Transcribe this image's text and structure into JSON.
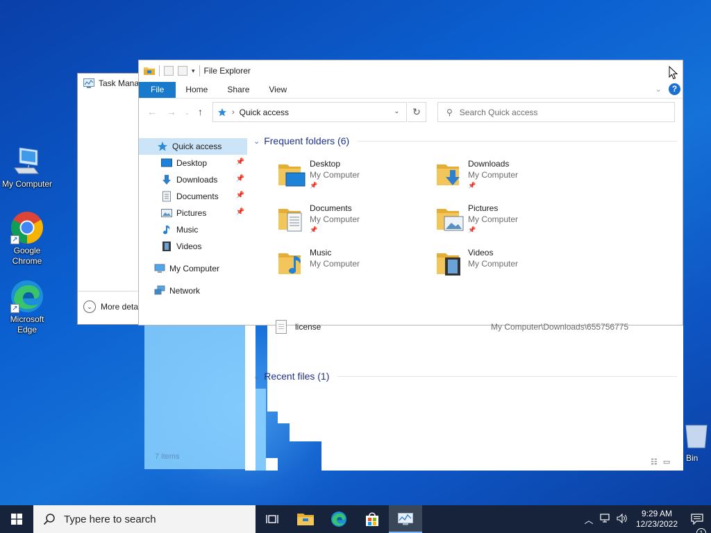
{
  "desktop": {
    "icons": [
      {
        "label": "My Computer"
      },
      {
        "label": "Google Chrome"
      },
      {
        "label": "Microsoft Edge"
      }
    ],
    "recycle_bin_label": "Bin"
  },
  "task_manager": {
    "title": "Task Manag",
    "more_details": "More deta"
  },
  "explorer": {
    "title": "File Explorer",
    "ribbon_tabs": [
      "File",
      "Home",
      "Share",
      "View"
    ],
    "address": "Quick access",
    "search_placeholder": "Search Quick access",
    "nav": [
      {
        "label": "Quick access",
        "icon": "star-icon"
      },
      {
        "label": "Desktop",
        "icon": "desktop-icon",
        "pinned": true
      },
      {
        "label": "Downloads",
        "icon": "download-arrow-icon",
        "pinned": true
      },
      {
        "label": "Documents",
        "icon": "document-icon",
        "pinned": true
      },
      {
        "label": "Pictures",
        "icon": "picture-icon",
        "pinned": true
      },
      {
        "label": "Music",
        "icon": "music-note-icon"
      },
      {
        "label": "Videos",
        "icon": "film-icon"
      },
      {
        "label": "My Computer",
        "icon": "computer-icon"
      },
      {
        "label": "Network",
        "icon": "network-icon"
      }
    ],
    "frequent_header": "Frequent folders (6)",
    "folders": [
      {
        "name": "Desktop",
        "location": "My Computer",
        "pinned": true
      },
      {
        "name": "Downloads",
        "location": "My Computer",
        "pinned": true
      },
      {
        "name": "Documents",
        "location": "My Computer",
        "pinned": true
      },
      {
        "name": "Pictures",
        "location": "My Computer",
        "pinned": true
      },
      {
        "name": "Music",
        "location": "My Computer",
        "pinned": false
      },
      {
        "name": "Videos",
        "location": "My Computer",
        "pinned": false
      }
    ],
    "recent_header": "Recent files (1)",
    "recent_files": [
      {
        "name": "license",
        "path": "My Computer\\Downloads\\655756775"
      }
    ],
    "status_items": "7 items"
  },
  "taskbar": {
    "search_placeholder": "Type here to search",
    "time": "9:29 AM",
    "date": "12/23/2022",
    "notification_count": "1"
  },
  "colors": {
    "accent": "#1979ca",
    "selected_nav": "#cce4f7",
    "group_header": "#1e3287",
    "taskbar": "#16233a",
    "folder_yellow": "#f2c65a"
  }
}
